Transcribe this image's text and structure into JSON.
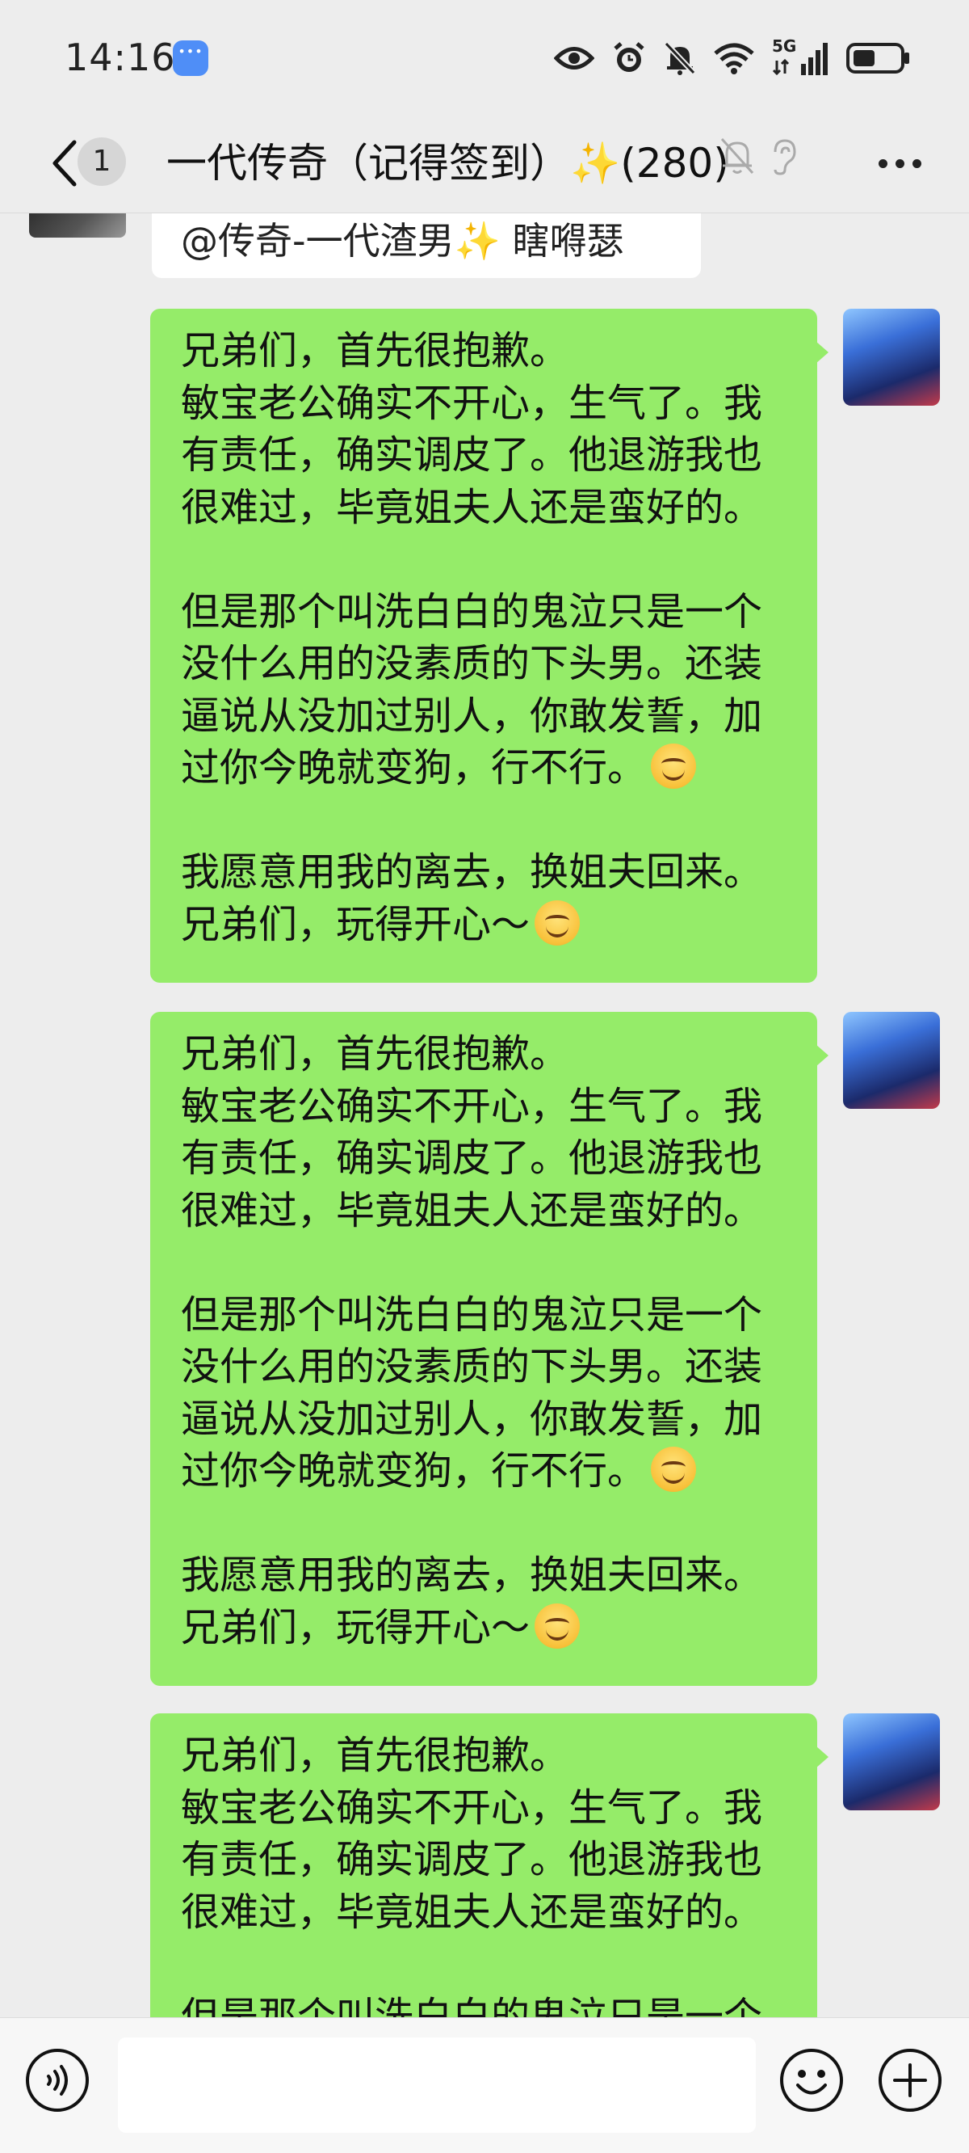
{
  "status_bar": {
    "time": "14:16",
    "network_label": "5G"
  },
  "header": {
    "unread_count": "1",
    "title": "一代传奇（记得签到）✨(280)"
  },
  "chat": {
    "quote_text": "@传奇-一代渣男✨  瞎嘚瑟",
    "messages": [
      {
        "paragraphs": [
          [
            "兄弟们，首先很抱歉。",
            "敏宝老公确实不开心，生气了。我",
            "有责任，确实调皮了。他退游我也",
            "很难过，毕竟姐夫人还是蛮好的。"
          ],
          [
            "但是那个叫洗白白的鬼泣只是一个",
            "没什么用的没素质的下头男。还装",
            "逼说从没加过别人，你敢发誓，加",
            "过你今晚就变狗，行不行。"
          ],
          [
            "我愿意用我的离去，换姐夫回来。",
            "兄弟们，玩得开心～"
          ]
        ]
      },
      {
        "paragraphs": [
          [
            "兄弟们，首先很抱歉。",
            "敏宝老公确实不开心，生气了。我",
            "有责任，确实调皮了。他退游我也",
            "很难过，毕竟姐夫人还是蛮好的。"
          ],
          [
            "但是那个叫洗白白的鬼泣只是一个",
            "没什么用的没素质的下头男。还装",
            "逼说从没加过别人，你敢发誓，加",
            "过你今晚就变狗，行不行。"
          ],
          [
            "我愿意用我的离去，换姐夫回来。",
            "兄弟们，玩得开心～"
          ]
        ]
      },
      {
        "paragraphs": [
          [
            "兄弟们，首先很抱歉。",
            "敏宝老公确实不开心，生气了。我",
            "有责任，确实调皮了。他退游我也",
            "很难过，毕竟姐夫人还是蛮好的。"
          ],
          [
            "但是那个叫洗白白的鬼泣只是一个"
          ]
        ]
      }
    ]
  },
  "input_bar": {
    "message_value": ""
  },
  "colors": {
    "bubble_green": "#95ec69",
    "background": "#ededed"
  },
  "icons": [
    "back-icon",
    "mute-icon",
    "ear-icon",
    "more-icon",
    "voice-icon",
    "emoji-icon",
    "plus-icon",
    "eye-icon",
    "alarm-icon",
    "silent-icon",
    "wifi-icon",
    "signal-icon",
    "battery-icon"
  ]
}
